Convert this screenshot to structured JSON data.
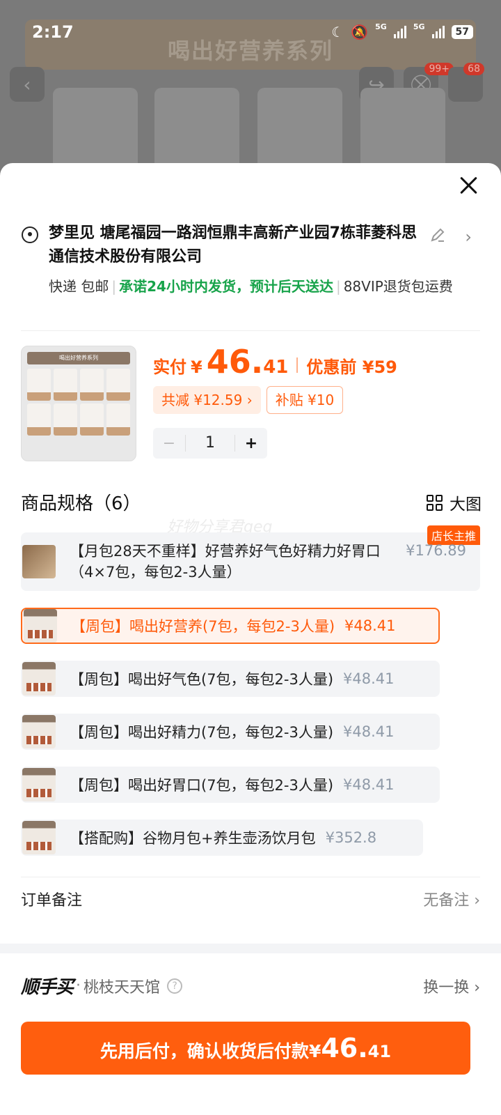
{
  "status_bar": {
    "time": "2:17",
    "network": "5G",
    "battery": "57"
  },
  "background": {
    "banner_title": "喝出好营养系列",
    "cart_badge": "99+",
    "msg_badge": "68",
    "icons": [
      "back-icon",
      "share-icon",
      "cart-icon",
      "message-icon"
    ]
  },
  "address": {
    "text": "梦里见 塘尾福园一路润恒鼎丰高新产业园7栋菲菱科思通信技术股份有限公司",
    "shipping_method": "快递 包邮",
    "promise": "承诺24小时内发货，预计后天送达",
    "vip": "88VIP退货包运费"
  },
  "product": {
    "image_header": "喝出好营养系列",
    "pay_label": "实付",
    "currency": "¥",
    "price_int": "46.",
    "price_dec": "41",
    "orig_label": "优惠前 ¥59",
    "discount_chip": "共减 ¥12.59 ›",
    "subsidy_chip": "补贴 ¥10",
    "quantity": "1",
    "minus": "−",
    "plus": "+"
  },
  "specs": {
    "title": "商品规格（6）",
    "big_view": "大图",
    "watermark": "好物分享君qeq",
    "hot_tag": "店长主推",
    "options": [
      {
        "name": "【月包28天不重样】好营养好气色好精力好胃口（4×7包，每包2-3人量）",
        "price": "¥176.89"
      },
      {
        "name": "【周包】喝出好营养(7包，每包2-3人量)",
        "price": "¥48.41"
      },
      {
        "name": "【周包】喝出好气色(7包，每包2-3人量)",
        "price": "¥48.41"
      },
      {
        "name": "【周包】喝出好精力(7包，每包2-3人量)",
        "price": "¥48.41"
      },
      {
        "name": "【周包】喝出好胃口(7包，每包2-3人量)",
        "price": "¥48.41"
      },
      {
        "name": "【搭配购】谷物月包+养生壶汤饮月包",
        "price": "¥352.8"
      }
    ],
    "selected_index": 1
  },
  "remark": {
    "label": "订单备注",
    "value": "无备注 ›"
  },
  "shunshou": {
    "logo": "顺手买",
    "dot": "·",
    "shop": "桃枝天天馆",
    "help": "?",
    "swap": "换一换 ›"
  },
  "cta": {
    "prefix": "先用后付，确认收货后付款",
    "currency": "¥",
    "int": "46.",
    "dec": "41"
  },
  "colors": {
    "accent": "#ff5e0e",
    "green": "#17a34a"
  }
}
